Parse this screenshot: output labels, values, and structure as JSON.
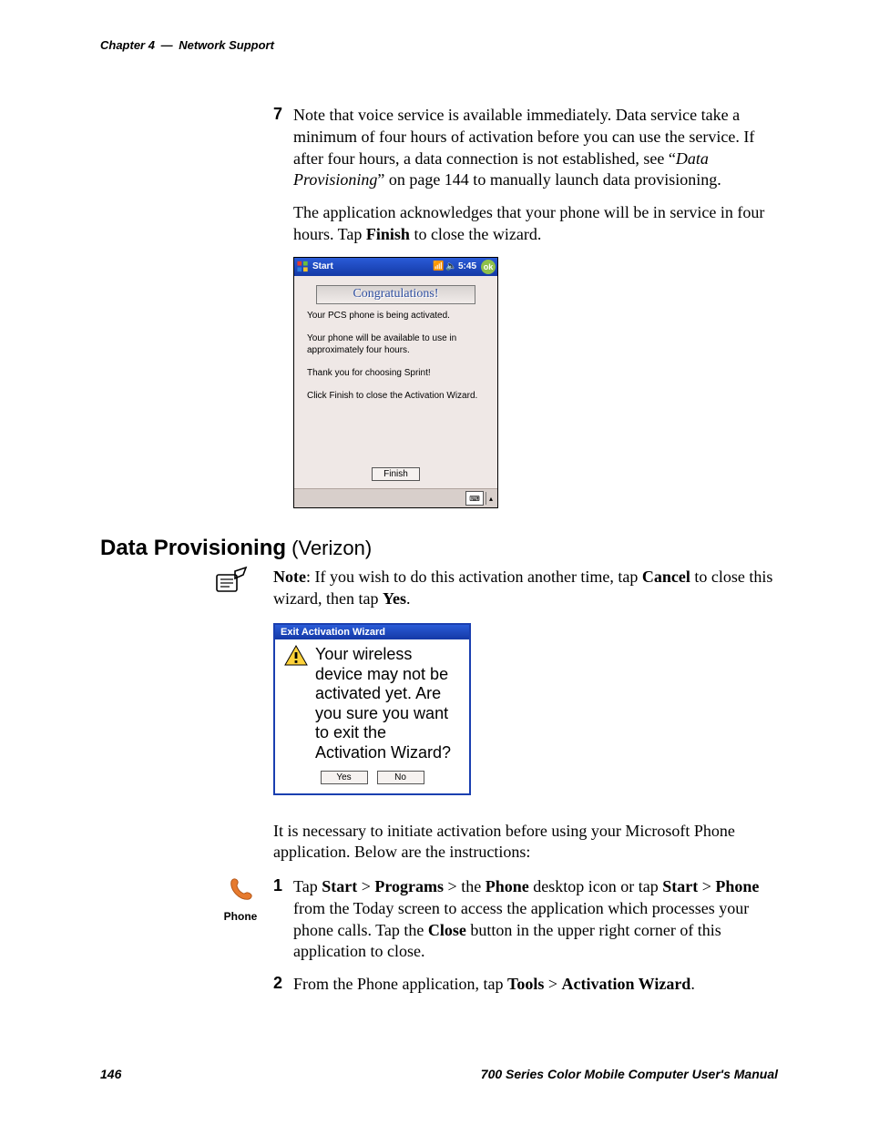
{
  "running_head": {
    "chapter": "Chapter 4",
    "sep": "—",
    "title": "Network Support"
  },
  "step7": {
    "num": "7",
    "p1_a": "Note that voice service is available immediately. Data service take a minimum of four hours of activation before you can use the service. If after four hours, a data connection is not established, see “",
    "p1_link": "Data Provisioning",
    "p1_b": "” on page 144 to manually launch data provisioning.",
    "p2_a": "The application acknowledges that your phone will be in service in four hours. Tap ",
    "p2_bold": "Finish",
    "p2_b": " to close the wizard."
  },
  "wm": {
    "start": "Start",
    "time": "5:45",
    "ok": "ok",
    "congrats": "Congratulations!",
    "msg_l1": "Your PCS phone is being activated.",
    "msg_l2": "Your phone will be available to use in approximately four hours.",
    "msg_l3": "Thank you for choosing Sprint!",
    "msg_l4": "Click Finish to close the Activation Wizard.",
    "finish": "Finish"
  },
  "section": {
    "title_bold": "Data Provisioning",
    "title_thin": " (Verizon)"
  },
  "note": {
    "lead": "Note",
    "a": ": If you wish to do this activation another time, tap ",
    "cancel": "Cancel",
    "b": " to close this wizard, then tap ",
    "yes": "Yes",
    "c": "."
  },
  "exit_dialog": {
    "title": "Exit Activation Wizard",
    "text": "Your wireless device may not be activated yet.  Are you sure you want to exit the Activation Wizard?",
    "yes": "Yes",
    "no": "No"
  },
  "intro_para": "It is necessary to initiate activation before using your Microsoft Phone application. Below are the instructions:",
  "phone_label": "Phone",
  "step1": {
    "num": "1",
    "a": "Tap ",
    "start": "Start",
    "gt1": " > ",
    "programs": "Programs",
    "gt2": " > the ",
    "phone": "Phone",
    "b": " desktop icon or tap ",
    "start2": "Start",
    "gt3": " > ",
    "phone2": "Phone",
    "c": " from the Today screen to access the application which processes your phone calls. Tap the ",
    "close": "Close",
    "d": " button in the upper right corner of this application to close."
  },
  "step2": {
    "num": "2",
    "a": "From the Phone application, tap ",
    "tools": "Tools",
    "gt": " > ",
    "aw": "Activation Wizard",
    "b": "."
  },
  "footer": {
    "page": "146",
    "manual": "700 Series Color Mobile Computer User's Manual"
  }
}
